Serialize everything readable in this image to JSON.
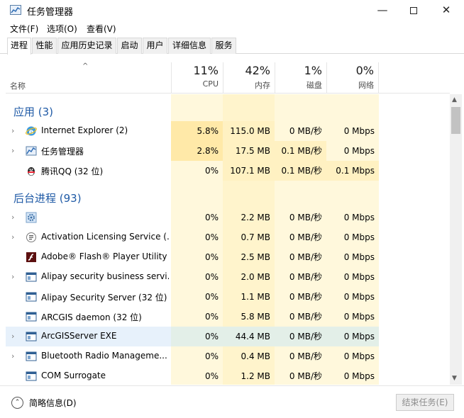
{
  "window": {
    "title": "任务管理器",
    "minimize": "—",
    "close": "✕"
  },
  "menu": [
    "文件(F)",
    "选项(O)",
    "查看(V)"
  ],
  "tabs": [
    "进程",
    "性能",
    "应用历史记录",
    "启动",
    "用户",
    "详细信息",
    "服务"
  ],
  "active_tab": 0,
  "header": {
    "sort_arrow": "^",
    "name": "名称",
    "cpu": {
      "pct": "11%",
      "label": "CPU"
    },
    "mem": {
      "pct": "42%",
      "label": "内存"
    },
    "disk": {
      "pct": "1%",
      "label": "磁盘"
    },
    "net": {
      "pct": "0%",
      "label": "网络"
    }
  },
  "groups": {
    "apps": "应用 (3)",
    "background": "后台进程 (93)"
  },
  "apps": [
    {
      "name": "Internet Explorer (2)",
      "icon": "ie-icon",
      "cpu": "5.8%",
      "mem": "115.0 MB",
      "disk": "0 MB/秒",
      "net": "0 Mbps",
      "expand": "›"
    },
    {
      "name": "任务管理器",
      "icon": "task-manager-icon",
      "cpu": "2.8%",
      "mem": "17.5 MB",
      "disk": "0.1 MB/秒",
      "net": "0 Mbps",
      "expand": "›"
    },
    {
      "name": "腾讯QQ (32 位)",
      "icon": "qq-icon",
      "cpu": "0%",
      "mem": "107.1 MB",
      "disk": "0.1 MB/秒",
      "net": "0.1 Mbps",
      "expand": ""
    }
  ],
  "background": [
    {
      "name": "",
      "icon": "gear-icon",
      "cpu": "0%",
      "mem": "2.2 MB",
      "disk": "0 MB/秒",
      "net": "0 Mbps",
      "expand": "›"
    },
    {
      "name": "Activation Licensing Service (...",
      "icon": "service-icon",
      "cpu": "0%",
      "mem": "0.7 MB",
      "disk": "0 MB/秒",
      "net": "0 Mbps",
      "expand": "›"
    },
    {
      "name": "Adobe® Flash® Player Utility",
      "icon": "flash-icon",
      "cpu": "0%",
      "mem": "2.5 MB",
      "disk": "0 MB/秒",
      "net": "0 Mbps",
      "expand": ""
    },
    {
      "name": "Alipay security business servi...",
      "icon": "window-icon",
      "cpu": "0%",
      "mem": "2.0 MB",
      "disk": "0 MB/秒",
      "net": "0 Mbps",
      "expand": "›"
    },
    {
      "name": "Alipay Security Server (32 位)",
      "icon": "window-icon",
      "cpu": "0%",
      "mem": "1.1 MB",
      "disk": "0 MB/秒",
      "net": "0 Mbps",
      "expand": ""
    },
    {
      "name": "ARCGIS daemon (32 位)",
      "icon": "window-icon",
      "cpu": "0%",
      "mem": "5.8 MB",
      "disk": "0 MB/秒",
      "net": "0 Mbps",
      "expand": ""
    },
    {
      "name": "ArcGISServer EXE",
      "icon": "window-icon",
      "cpu": "0%",
      "mem": "44.4 MB",
      "disk": "0 MB/秒",
      "net": "0 Mbps",
      "expand": "›",
      "selected": true
    },
    {
      "name": "Bluetooth Radio Manageme...",
      "icon": "window-icon",
      "cpu": "0%",
      "mem": "0.4 MB",
      "disk": "0 MB/秒",
      "net": "0 Mbps",
      "expand": "›"
    },
    {
      "name": "COM Surrogate",
      "icon": "window-icon",
      "cpu": "0%",
      "mem": "1.2 MB",
      "disk": "0 MB/秒",
      "net": "0 Mbps",
      "expand": ""
    }
  ],
  "footer": {
    "fewer_details": "简略信息(D)",
    "end_task": "结束任务(E)"
  },
  "colors": {
    "group_title": "#1f5aa6",
    "heat_light": "#fff8dc",
    "heat_mid": "#fff1c2",
    "heat_strong": "#ffe9a8"
  }
}
